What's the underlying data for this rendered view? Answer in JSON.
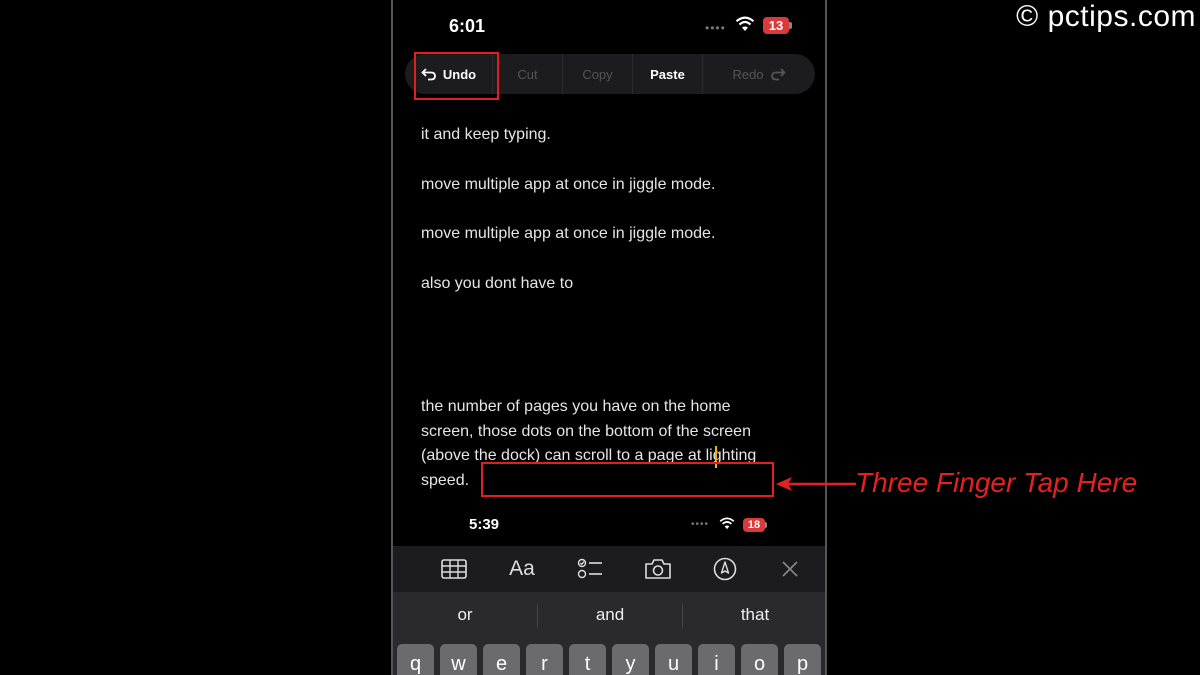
{
  "watermark": "© pctips.com",
  "top_status": {
    "time": "6:01",
    "battery": "13"
  },
  "edit_menu": {
    "undo": "Undo",
    "cut": "Cut",
    "copy": "Copy",
    "paste": "Paste",
    "redo": "Redo"
  },
  "note_lines": [
    "it and keep typing.",
    "move multiple app at once in jiggle mode.",
    "move multiple app at once in jiggle mode.",
    "also you dont have to",
    "the number of pages you have on the home",
    "screen, those dots on the bottom of the screen",
    "(above the dock) can scroll to a page at lighting",
    "speed."
  ],
  "inner_status": {
    "time": "5:39",
    "battery": "18"
  },
  "keyboard_toolbar": {
    "icons": [
      "table-icon",
      "text-format-icon",
      "checklist-icon",
      "camera-icon",
      "markup-icon",
      "close-icon"
    ],
    "format_label": "Aa"
  },
  "suggestions": [
    "or",
    "and",
    "that"
  ],
  "keys": [
    "q",
    "w",
    "e",
    "r",
    "t",
    "y",
    "u",
    "i",
    "o",
    "p"
  ],
  "annotation": "Three Finger Tap Here",
  "colors": {
    "highlight": "#e02020",
    "cursor": "#f0b400",
    "battery": "#d93a3a"
  }
}
